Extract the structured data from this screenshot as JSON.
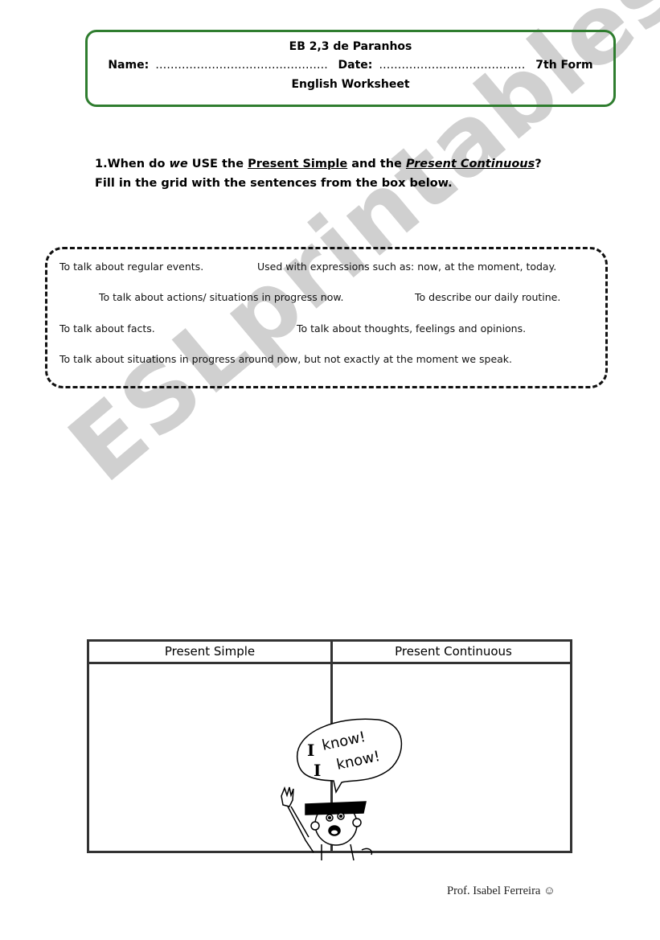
{
  "header": {
    "school": "EB 2,3 de Paranhos",
    "name_label": "Name:",
    "name_dots": "……………………………………….",
    "date_label": "Date:",
    "date_dots": "…………………………………",
    "form": "7th Form",
    "subtitle": "English Worksheet"
  },
  "instructions": {
    "q_prefix": "1.When do ",
    "q_we": "we",
    "q_use": " USE the ",
    "q_simple": "Present Simple",
    "q_and": " and the ",
    "q_continuous": "Present Continuous",
    "q_end": "?",
    "line2": "Fill in the grid with the sentences from the box below."
  },
  "sentence_box": {
    "sentences": [
      "To talk about regular events.",
      "Used with expressions such as: now, at the moment, today.",
      "To talk about actions/ situations in progress now.",
      "To describe our daily routine.",
      "To talk about facts.",
      "To talk about thoughts, feelings and opinions.",
      "To talk about situations in progress around now, but not exactly at the moment we speak."
    ]
  },
  "grid": {
    "columns": [
      "Present Simple",
      "Present Continuous"
    ]
  },
  "cartoon": {
    "speech_line1_a": "I",
    "speech_line1_b": "know!",
    "speech_line2_a": "I",
    "speech_line2_b": "know!"
  },
  "watermark": "ESLprintables.com",
  "footer": {
    "author": "Prof. Isabel Ferreira ☺"
  },
  "colors": {
    "header_border": "#2f7d2f",
    "watermark": "#c8c8c8"
  }
}
